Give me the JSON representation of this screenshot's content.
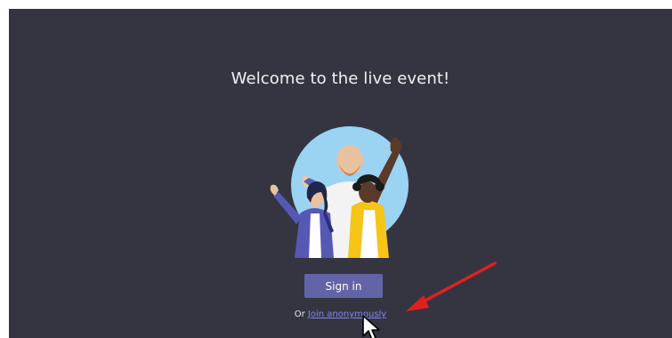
{
  "page": {
    "welcome_title": "Welcome to the live event!"
  },
  "actions": {
    "sign_in_label": "Sign in",
    "or_text": "Or",
    "join_anonymously_label": "Join anonymously"
  },
  "icons": {
    "illustration": "people-waving-illustration",
    "annotation": "red-arrow-icon",
    "pointer": "mouse-cursor-icon"
  },
  "colors": {
    "background": "#353541",
    "primary_button": "#6264a7",
    "link": "#7f85f5",
    "annotation_arrow": "#e02020"
  }
}
